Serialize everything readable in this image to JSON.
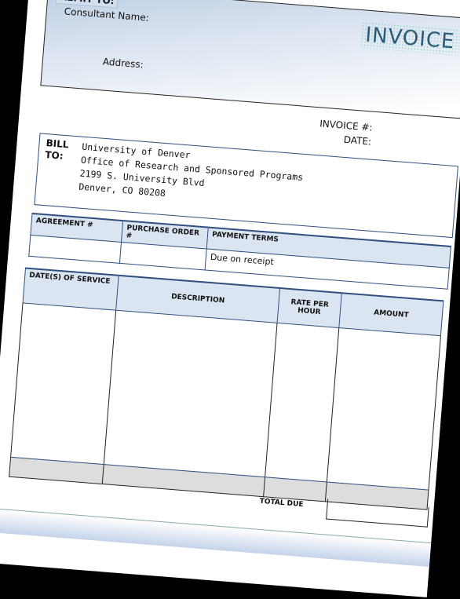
{
  "remit": {
    "title": "REMIT TO:",
    "consultant_label": "Consultant  Name:",
    "address_label": "Address:"
  },
  "invoice_title": "INVOICE",
  "meta": {
    "invoice_no_label": "INVOICE #:",
    "date_label": "DATE:"
  },
  "bill_to": {
    "label_1": "BILL",
    "label_2": "TO:",
    "lines": [
      "University of Denver",
      "Office of Research and Sponsored Programs",
      "2199 S. University Blvd",
      "Denver, CO  80208"
    ]
  },
  "terms_table": {
    "headers": [
      "AGREEMENT #",
      "PURCHASE ORDER #",
      "PAYMENT TERMS"
    ],
    "values": [
      "",
      "",
      "Due on receipt"
    ]
  },
  "service_table": {
    "headers": [
      "DATE(S) OF SERVICE",
      "DESCRIPTION",
      "RATE PER HOUR",
      "AMOUNT"
    ]
  },
  "total_due_label": "TOTAL DUE",
  "colors": {
    "header_fill": "#dbe5f1",
    "border": "#2f4f7f",
    "title": "#2a5a78"
  }
}
